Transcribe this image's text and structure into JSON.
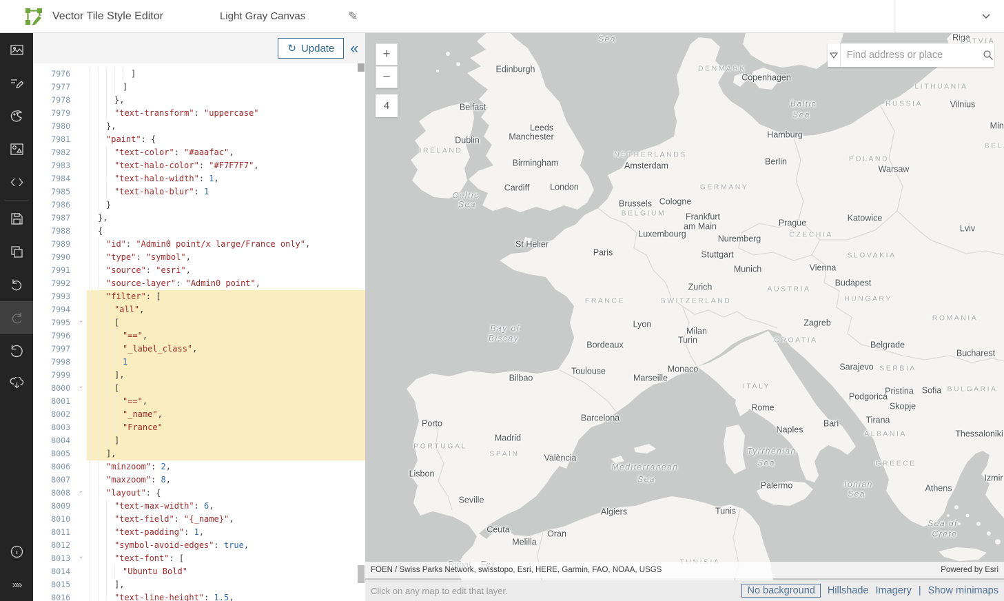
{
  "header": {
    "app_title": "Vector Tile Style Editor",
    "style_name": "Light Gray Canvas",
    "logo_color": "#71a83c"
  },
  "sidebar": {
    "items": [
      {
        "name": "layer-styles",
        "icon": "image-icon",
        "state": "normal"
      },
      {
        "name": "quick-edit",
        "icon": "edit-lines-icon",
        "state": "normal"
      },
      {
        "name": "edit-by-color",
        "icon": "palette-icon",
        "state": "normal"
      },
      {
        "name": "sprites",
        "icon": "sprite-icon",
        "state": "normal"
      },
      {
        "name": "code",
        "icon": "code-icon",
        "state": "normal"
      },
      {
        "name": "divider",
        "icon": "",
        "state": "divider"
      },
      {
        "name": "save",
        "icon": "save-icon",
        "state": "normal"
      },
      {
        "name": "save-as",
        "icon": "duplicate-icon",
        "state": "normal"
      },
      {
        "name": "undo",
        "icon": "undo-icon",
        "state": "normal"
      },
      {
        "name": "redo",
        "icon": "redo-icon",
        "state": "disabled"
      },
      {
        "name": "revert",
        "icon": "reset-icon",
        "state": "normal"
      },
      {
        "name": "export",
        "icon": "cloud-download-icon",
        "state": "normal"
      }
    ],
    "bottom_items": [
      {
        "name": "info",
        "icon": "info-icon"
      },
      {
        "name": "expand",
        "icon": "double-chevron-right-icon"
      }
    ]
  },
  "editor": {
    "update_label": "Update",
    "collapse_glyph": "«",
    "lines": [
      [
        7976,
        6,
        0,
        0,
        [
          [
            "p",
            "]"
          ]
        ]
      ],
      [
        7977,
        5,
        0,
        0,
        [
          [
            "p",
            "]"
          ]
        ]
      ],
      [
        7978,
        4,
        0,
        0,
        [
          [
            "p",
            "},"
          ]
        ]
      ],
      [
        7979,
        4,
        0,
        0,
        [
          [
            "s",
            "\"text-transform\""
          ],
          [
            "p",
            ": "
          ],
          [
            "s",
            "\"uppercase\""
          ]
        ]
      ],
      [
        7980,
        3,
        0,
        0,
        [
          [
            "p",
            "},"
          ]
        ]
      ],
      [
        7981,
        3,
        0,
        0,
        [
          [
            "s",
            "\"paint\""
          ],
          [
            "p",
            ": {"
          ]
        ]
      ],
      [
        7982,
        4,
        0,
        0,
        [
          [
            "s",
            "\"text-color\""
          ],
          [
            "p",
            ": "
          ],
          [
            "s",
            "\"#aaafac\""
          ],
          [
            "p",
            ","
          ]
        ]
      ],
      [
        7983,
        4,
        0,
        0,
        [
          [
            "s",
            "\"text-halo-color\""
          ],
          [
            "p",
            ": "
          ],
          [
            "s",
            "\"#F7F7F7\""
          ],
          [
            "p",
            ","
          ]
        ]
      ],
      [
        7984,
        4,
        0,
        0,
        [
          [
            "s",
            "\"text-halo-width\""
          ],
          [
            "p",
            ": "
          ],
          [
            "n",
            "1"
          ],
          [
            "p",
            ","
          ]
        ]
      ],
      [
        7985,
        4,
        0,
        0,
        [
          [
            "s",
            "\"text-halo-blur\""
          ],
          [
            "p",
            ": "
          ],
          [
            "n",
            "1"
          ]
        ]
      ],
      [
        7986,
        3,
        0,
        0,
        [
          [
            "p",
            "}"
          ]
        ]
      ],
      [
        7987,
        2,
        0,
        0,
        [
          [
            "p",
            "},"
          ]
        ]
      ],
      [
        7988,
        2,
        0,
        0,
        [
          [
            "p",
            "{"
          ]
        ]
      ],
      [
        7989,
        3,
        0,
        0,
        [
          [
            "s",
            "\"id\""
          ],
          [
            "p",
            ": "
          ],
          [
            "s",
            "\"Admin0 point/x large/France only\""
          ],
          [
            "p",
            ","
          ]
        ]
      ],
      [
        7990,
        3,
        0,
        0,
        [
          [
            "s",
            "\"type\""
          ],
          [
            "p",
            ": "
          ],
          [
            "s",
            "\"symbol\""
          ],
          [
            "p",
            ","
          ]
        ]
      ],
      [
        7991,
        3,
        0,
        0,
        [
          [
            "s",
            "\"source\""
          ],
          [
            "p",
            ": "
          ],
          [
            "s",
            "\"esri\""
          ],
          [
            "p",
            ","
          ]
        ]
      ],
      [
        7992,
        3,
        0,
        0,
        [
          [
            "s",
            "\"source-layer\""
          ],
          [
            "p",
            ": "
          ],
          [
            "s",
            "\"Admin0 point\""
          ],
          [
            "p",
            ","
          ]
        ]
      ],
      [
        7993,
        3,
        1,
        0,
        [
          [
            "s",
            "\"filter\""
          ],
          [
            "p",
            ": ["
          ]
        ]
      ],
      [
        7994,
        4,
        1,
        0,
        [
          [
            "s",
            "\"all\""
          ],
          [
            "p",
            ","
          ]
        ]
      ],
      [
        7995,
        4,
        1,
        1,
        [
          [
            "p",
            "["
          ]
        ]
      ],
      [
        7996,
        5,
        1,
        0,
        [
          [
            "s",
            "\"==\""
          ],
          [
            "p",
            ","
          ]
        ]
      ],
      [
        7997,
        5,
        1,
        0,
        [
          [
            "s",
            "\"_label_class\""
          ],
          [
            "p",
            ","
          ]
        ]
      ],
      [
        7998,
        5,
        1,
        0,
        [
          [
            "n",
            "1"
          ]
        ]
      ],
      [
        7999,
        4,
        1,
        0,
        [
          [
            "p",
            "],"
          ]
        ]
      ],
      [
        8000,
        4,
        1,
        1,
        [
          [
            "p",
            "["
          ]
        ]
      ],
      [
        8001,
        5,
        1,
        0,
        [
          [
            "s",
            "\"==\""
          ],
          [
            "p",
            ","
          ]
        ]
      ],
      [
        8002,
        5,
        1,
        0,
        [
          [
            "s",
            "\"_name\""
          ],
          [
            "p",
            ","
          ]
        ]
      ],
      [
        8003,
        5,
        1,
        0,
        [
          [
            "s",
            "\"France\""
          ]
        ]
      ],
      [
        8004,
        4,
        1,
        0,
        [
          [
            "p",
            "]"
          ]
        ]
      ],
      [
        8005,
        3,
        1,
        0,
        [
          [
            "p",
            "],"
          ]
        ]
      ],
      [
        8006,
        3,
        0,
        0,
        [
          [
            "s",
            "\"minzoom\""
          ],
          [
            "p",
            ": "
          ],
          [
            "n",
            "2"
          ],
          [
            "p",
            ","
          ]
        ]
      ],
      [
        8007,
        3,
        0,
        0,
        [
          [
            "s",
            "\"maxzoom\""
          ],
          [
            "p",
            ": "
          ],
          [
            "n",
            "8"
          ],
          [
            "p",
            ","
          ]
        ]
      ],
      [
        8008,
        3,
        0,
        1,
        [
          [
            "s",
            "\"layout\""
          ],
          [
            "p",
            ": {"
          ]
        ]
      ],
      [
        8009,
        4,
        0,
        0,
        [
          [
            "s",
            "\"text-max-width\""
          ],
          [
            "p",
            ": "
          ],
          [
            "n",
            "6"
          ],
          [
            "p",
            ","
          ]
        ]
      ],
      [
        8010,
        4,
        0,
        0,
        [
          [
            "s",
            "\"text-field\""
          ],
          [
            "p",
            ": "
          ],
          [
            "s",
            "\"{_name}\""
          ],
          [
            "p",
            ","
          ]
        ]
      ],
      [
        8011,
        4,
        0,
        0,
        [
          [
            "s",
            "\"text-padding\""
          ],
          [
            "p",
            ": "
          ],
          [
            "n",
            "1"
          ],
          [
            "p",
            ","
          ]
        ]
      ],
      [
        8012,
        4,
        0,
        0,
        [
          [
            "s",
            "\"symbol-avoid-edges\""
          ],
          [
            "p",
            ": "
          ],
          [
            "n",
            "true"
          ],
          [
            "p",
            ","
          ]
        ]
      ],
      [
        8013,
        4,
        0,
        1,
        [
          [
            "s",
            "\"text-font\""
          ],
          [
            "p",
            ": ["
          ]
        ]
      ],
      [
        8014,
        5,
        0,
        0,
        [
          [
            "s",
            "\"Ubuntu Bold\""
          ]
        ]
      ],
      [
        8015,
        4,
        0,
        0,
        [
          [
            "p",
            "],"
          ]
        ]
      ],
      [
        8016,
        4,
        0,
        0,
        [
          [
            "s",
            "\"text-line-height\""
          ],
          [
            "p",
            ": "
          ],
          [
            "n",
            "1.5"
          ],
          [
            "p",
            ","
          ]
        ]
      ]
    ],
    "highlight_color": "#faeec0",
    "string_color": "#a22a2a",
    "number_color": "#2e6cb0"
  },
  "map": {
    "zoom_in": "+",
    "zoom_out": "−",
    "zoom_level": "4",
    "search_placeholder": "Find address or place",
    "attribution": "FOEN / Swiss Parks Network, swisstopo, Esri, HERE, Garmin, FAO, NOAA, USGS",
    "powered_by": "Powered by Esri",
    "sea_color": "#c9cbca",
    "land_color": "#f5f4f2",
    "labels": [
      [
        "Sea",
        351,
        9,
        "s"
      ],
      [
        "Riga",
        865,
        7,
        "c"
      ],
      [
        "LATVIA",
        889,
        12,
        "C"
      ],
      [
        "Edinburgh",
        218,
        53,
        "c"
      ],
      [
        "DENMARK",
        518,
        52,
        "C"
      ],
      [
        "Copenhagen",
        582,
        65,
        "c"
      ],
      [
        "LITHUANIA",
        836,
        78,
        "C"
      ],
      [
        "RUSSIA",
        782,
        103,
        "C"
      ],
      [
        "Vilnius",
        867,
        104,
        "c"
      ],
      [
        "Baltic",
        636,
        103,
        "s"
      ],
      [
        "Sea",
        633,
        119,
        "s"
      ],
      [
        "Belfast",
        156,
        108,
        "c"
      ],
      [
        "Minsk",
        923,
        135,
        "c"
      ],
      [
        "BELARUS",
        932,
        164,
        "C"
      ],
      [
        "Leeds",
        256,
        138,
        "c"
      ],
      [
        "Manchester",
        241,
        151,
        "c"
      ],
      [
        "Hamburg",
        609,
        148,
        "c"
      ],
      [
        "Dublin",
        148,
        156,
        "c"
      ],
      [
        "IRELAND",
        110,
        171,
        "C"
      ],
      [
        "Birmingham",
        247,
        189,
        "c"
      ],
      [
        "Berlin",
        596,
        187,
        "c"
      ],
      [
        "POLAND",
        731,
        183,
        "C"
      ],
      [
        "Warsaw",
        767,
        198,
        "c"
      ],
      [
        "NETHERLANDS",
        414,
        177,
        "C"
      ],
      [
        "Amsterdam",
        408,
        193,
        "c"
      ],
      [
        "Cardiff",
        220,
        225,
        "c"
      ],
      [
        "London",
        289,
        224,
        "c"
      ],
      [
        "GERMANY",
        521,
        224,
        "C"
      ],
      [
        "Celtic",
        146,
        236,
        "s"
      ],
      [
        "Sea",
        148,
        249,
        "s"
      ],
      [
        "Brussels",
        392,
        248,
        "c"
      ],
      [
        "Cologne",
        450,
        245,
        "c"
      ],
      [
        "BELGIUM",
        404,
        262,
        "C"
      ],
      [
        "Frankfurt",
        490,
        267,
        "c"
      ],
      [
        "am Main",
        486,
        281,
        "c"
      ],
      [
        "Prague",
        620,
        276,
        "c"
      ],
      [
        "Katowice",
        725,
        269,
        "c"
      ],
      [
        "Lviv",
        874,
        284,
        "c"
      ],
      [
        "St Helier",
        242,
        307,
        "c"
      ],
      [
        "Luxembourg",
        431,
        292,
        "c"
      ],
      [
        "Nuremberg",
        543,
        299,
        "c"
      ],
      [
        "CZECHIA",
        647,
        293,
        "C"
      ],
      [
        "Paris",
        345,
        319,
        "c"
      ],
      [
        "Stuttgart",
        511,
        322,
        "c"
      ],
      [
        "SLOVAKIA",
        735,
        323,
        "C"
      ],
      [
        "Munich",
        555,
        343,
        "c"
      ],
      [
        "Vienna",
        664,
        341,
        "c"
      ],
      [
        "Zurich",
        486,
        369,
        "c"
      ],
      [
        "Budapest",
        708,
        363,
        "c"
      ],
      [
        "AUSTRIA",
        615,
        372,
        "C"
      ],
      [
        "FRANCE",
        348,
        389,
        "C"
      ],
      [
        "SWITZERLAND",
        480,
        389,
        "C"
      ],
      [
        "HUNGARY",
        730,
        386,
        "C"
      ],
      [
        "Lyon",
        402,
        423,
        "c"
      ],
      [
        "Bay of",
        203,
        429,
        "s"
      ],
      [
        "Biscay",
        201,
        443,
        "s"
      ],
      [
        "Milan",
        481,
        433,
        "c"
      ],
      [
        "Turin",
        468,
        446,
        "c"
      ],
      [
        "Zagreb",
        656,
        421,
        "c"
      ],
      [
        "ROMANIA",
        856,
        414,
        "C"
      ],
      [
        "CROATIA",
        625,
        446,
        "C"
      ],
      [
        "Belgrade",
        758,
        453,
        "c"
      ],
      [
        "Bordeaux",
        348,
        453,
        "c"
      ],
      [
        "Bucharest",
        886,
        465,
        "c"
      ],
      [
        "Sarajevo",
        713,
        485,
        "c"
      ],
      [
        "SERBIA",
        773,
        487,
        "C"
      ],
      [
        "Toulouse",
        324,
        491,
        "c"
      ],
      [
        "Monaco",
        461,
        488,
        "c"
      ],
      [
        "Marseille",
        414,
        501,
        "c"
      ],
      [
        "Bilbao",
        226,
        501,
        "c"
      ],
      [
        "ITALY",
        568,
        513,
        "C"
      ],
      [
        "Pristina",
        775,
        520,
        "c"
      ],
      [
        "Sofia",
        822,
        519,
        "c"
      ],
      [
        "BULGARIA",
        881,
        517,
        "C"
      ],
      [
        "Podgorica",
        730,
        528,
        "c"
      ],
      [
        "Skopje",
        780,
        542,
        "c"
      ],
      [
        "Rome",
        577,
        544,
        "c"
      ],
      [
        "Barcelona",
        341,
        559,
        "c"
      ],
      [
        "Tirana",
        744,
        562,
        "c"
      ],
      [
        "Bari",
        676,
        567,
        "c"
      ],
      [
        "Porto",
        97,
        567,
        "c"
      ],
      [
        "Naples",
        616,
        576,
        "c"
      ],
      [
        "ALBANIA",
        755,
        582,
        "C"
      ],
      [
        "Thessaloniki",
        891,
        582,
        "c"
      ],
      [
        "PORTUGAL",
        109,
        600,
        "C"
      ],
      [
        "Madrid",
        207,
        588,
        "c"
      ],
      [
        "SPAIN",
        202,
        611,
        "C"
      ],
      [
        "València",
        283,
        617,
        "c"
      ],
      [
        "Tyrrhenian",
        590,
        607,
        "s"
      ],
      [
        "Sea",
        582,
        624,
        "s"
      ],
      [
        "Mediterranean",
        406,
        630,
        "s"
      ],
      [
        "Sea",
        408,
        648,
        "s"
      ],
      [
        "Lisbon",
        82,
        640,
        "c"
      ],
      [
        "GREECE",
        770,
        625,
        "C"
      ],
      [
        "Ionian",
        716,
        655,
        "s"
      ],
      [
        "Sea",
        713,
        669,
        "s"
      ],
      [
        "Athens",
        832,
        661,
        "c"
      ],
      [
        "Izmir",
        912,
        646,
        "c"
      ],
      [
        "Palermo",
        597,
        657,
        "c"
      ],
      [
        "Seville",
        154,
        678,
        "c"
      ],
      [
        "Algiers",
        361,
        695,
        "c"
      ],
      [
        "Tunis",
        523,
        694,
        "c"
      ],
      [
        "Sea of",
        838,
        712,
        "s"
      ],
      [
        "Crete",
        841,
        727,
        "s"
      ],
      [
        "Ceuta",
        193,
        721,
        "c"
      ],
      [
        "Oran",
        278,
        727,
        "c"
      ],
      [
        "Melilla",
        231,
        739,
        "c"
      ],
      [
        "Rabat",
        137,
        772,
        "c"
      ],
      [
        "Fez",
        178,
        772,
        "c"
      ],
      [
        "TUNISIA",
        486,
        768,
        "C"
      ]
    ]
  },
  "footer": {
    "hint": "Click on any map to edit that layer.",
    "background_options": [
      "No background",
      "Hillshade",
      "Imagery"
    ],
    "selected_background": "No background",
    "separator": "|",
    "minimap_toggle": "Show minimaps",
    "link_color": "#4f7094"
  }
}
